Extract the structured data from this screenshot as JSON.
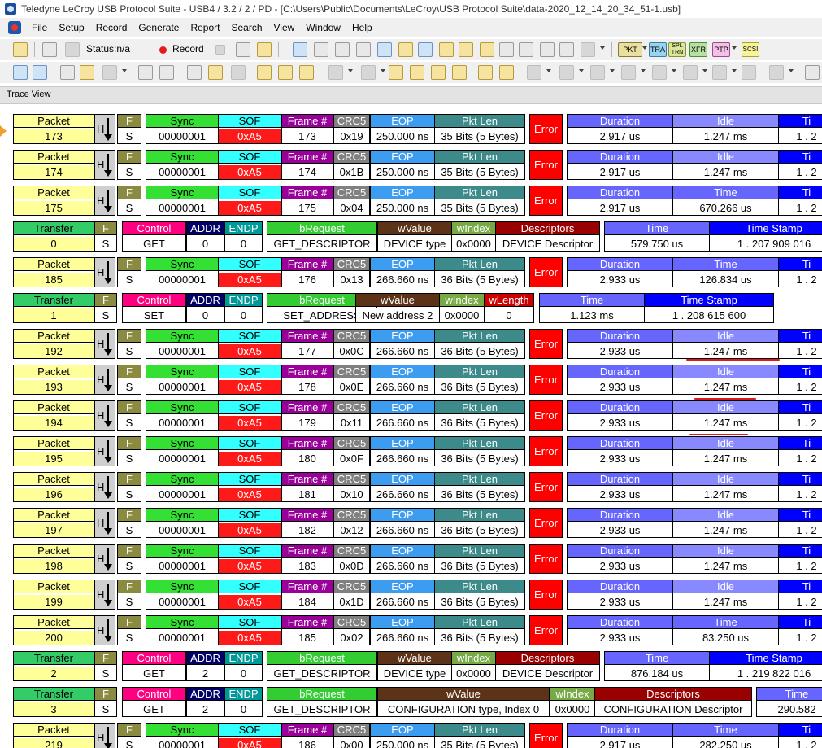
{
  "title": "Teledyne LeCroy USB Protocol Suite - USB4 / 3.2 / 2 / PD - [C:\\Users\\Public\\Documents\\LeCroy\\USB Protocol Suite\\data-2020_12_14_20_34_51-1.usb]",
  "menu": [
    "File",
    "Setup",
    "Record",
    "Generate",
    "Report",
    "Search",
    "View",
    "Window",
    "Help"
  ],
  "toolbar": {
    "status_label": "Status:n/a",
    "record_label": "Record",
    "pkt": "PKT",
    "tra": "TRA",
    "spl": "SPL TRN",
    "xfr": "XFR",
    "ptp": "PTP",
    "scsi": "SCSI"
  },
  "trace_view_title": "Trace View",
  "colors": {
    "yellow": "#ffff99",
    "sync": "#33e033",
    "sof": "#33ffff",
    "sof_val": "#ff1a1a",
    "frame": "#990099",
    "crc": "#808080",
    "eop": "#3c9cf0",
    "pktlen": "#3c8a8a",
    "error": "#ff0000",
    "duration": "#6666ff",
    "idle": "#8888ff",
    "time": "#6666ff",
    "timestamp": "#0000ff",
    "F": "#8a8a40",
    "transfer": "#33cc66",
    "control": "#ff0080",
    "addr": "#000066",
    "endp": "#009999",
    "brequest": "#33cc33",
    "wvalue": "#5c3317",
    "windex": "#77aa44",
    "desc": "#990000",
    "wlength": "#cc0000"
  },
  "records": [
    {
      "kind": "packet",
      "id": "173",
      "f": "S",
      "sync": "00000001",
      "sof": "0xA5",
      "frame": "173",
      "crc": "0x19",
      "eop": "250.000 ns",
      "pktlen": "35 Bits (5 Bytes)",
      "error": "Error",
      "dur": "2.917 us",
      "mid_label": "Idle",
      "mid": "1.247 ms",
      "tail": "1 . 2",
      "mark_left": true
    },
    {
      "kind": "packet",
      "id": "174",
      "f": "S",
      "sync": "00000001",
      "sof": "0xA5",
      "frame": "174",
      "crc": "0x1B",
      "eop": "250.000 ns",
      "pktlen": "35 Bits (5 Bytes)",
      "error": "Error",
      "dur": "2.917 us",
      "mid_label": "Idle",
      "mid": "1.247 ms",
      "tail": "1 . 2"
    },
    {
      "kind": "packet",
      "id": "175",
      "f": "S",
      "sync": "00000001",
      "sof": "0xA5",
      "frame": "175",
      "crc": "0x04",
      "eop": "250.000 ns",
      "pktlen": "35 Bits (5 Bytes)",
      "error": "Error",
      "dur": "2.917 us",
      "mid_label": "Time",
      "mid": "670.266 us",
      "tail": "1 . 2"
    },
    {
      "kind": "transfer",
      "id": "0",
      "f": "S",
      "control": "GET",
      "addr": "0",
      "endp": "0",
      "brequest": "GET_DESCRIPTOR",
      "wvalue": "DEVICE type",
      "windex": "0x0000",
      "desc": "DEVICE Descriptor",
      "time": "579.750 us",
      "stamp": "1 . 207 909 016",
      "variant": "a"
    },
    {
      "kind": "packet",
      "id": "185",
      "f": "S",
      "sync": "00000001",
      "sof": "0xA5",
      "frame": "176",
      "crc": "0x13",
      "eop": "266.660 ns",
      "pktlen": "36 Bits (5 Bytes)",
      "error": "Error",
      "dur": "2.933 us",
      "mid_label": "Time",
      "mid": "126.834 us",
      "tail": "1 . 2"
    },
    {
      "kind": "transfer",
      "id": "1",
      "f": "S",
      "control": "SET",
      "addr": "0",
      "endp": "0",
      "brequest": "SET_ADDRESS",
      "wvalue": "New address 2",
      "windex": "0x0000",
      "wlength": "0",
      "time": "1.123 ms",
      "stamp": "1 . 208 615 600",
      "variant": "b"
    },
    {
      "kind": "packet",
      "id": "192",
      "f": "S",
      "sync": "00000001",
      "sof": "0xA5",
      "frame": "177",
      "crc": "0x0C",
      "eop": "266.660 ns",
      "pktlen": "36 Bits (5 Bytes)",
      "error": "Error",
      "dur": "2.933 us",
      "mid_label": "Idle",
      "mid": "1.247 ms",
      "tail": "1 . 2"
    },
    {
      "kind": "packet",
      "id": "193",
      "f": "S",
      "sync": "00000001",
      "sof": "0xA5",
      "frame": "178",
      "crc": "0x0E",
      "eop": "266.660 ns",
      "pktlen": "36 Bits (5 Bytes)",
      "error": "Error",
      "dur": "2.933 us",
      "mid_label": "Idle",
      "mid": "1.247 ms",
      "tail": "1 . 2"
    },
    {
      "kind": "packet",
      "id": "194",
      "f": "S",
      "sync": "00000001",
      "sof": "0xA5",
      "frame": "179",
      "crc": "0x11",
      "eop": "266.660 ns",
      "pktlen": "36 Bits (5 Bytes)",
      "error": "Error",
      "dur": "2.933 us",
      "mid_label": "Idle",
      "mid": "1.247 ms",
      "tail": "1 . 2"
    },
    {
      "kind": "packet",
      "id": "195",
      "f": "S",
      "sync": "00000001",
      "sof": "0xA5",
      "frame": "180",
      "crc": "0x0F",
      "eop": "266.660 ns",
      "pktlen": "36 Bits (5 Bytes)",
      "error": "Error",
      "dur": "2.933 us",
      "mid_label": "Idle",
      "mid": "1.247 ms",
      "tail": "1 . 2"
    },
    {
      "kind": "packet",
      "id": "196",
      "f": "S",
      "sync": "00000001",
      "sof": "0xA5",
      "frame": "181",
      "crc": "0x10",
      "eop": "266.660 ns",
      "pktlen": "36 Bits (5 Bytes)",
      "error": "Error",
      "dur": "2.933 us",
      "mid_label": "Idle",
      "mid": "1.247 ms",
      "tail": "1 . 2"
    },
    {
      "kind": "packet",
      "id": "197",
      "f": "S",
      "sync": "00000001",
      "sof": "0xA5",
      "frame": "182",
      "crc": "0x12",
      "eop": "266.660 ns",
      "pktlen": "36 Bits (5 Bytes)",
      "error": "Error",
      "dur": "2.933 us",
      "mid_label": "Idle",
      "mid": "1.247 ms",
      "tail": "1 . 2"
    },
    {
      "kind": "packet",
      "id": "198",
      "f": "S",
      "sync": "00000001",
      "sof": "0xA5",
      "frame": "183",
      "crc": "0x0D",
      "eop": "266.660 ns",
      "pktlen": "36 Bits (5 Bytes)",
      "error": "Error",
      "dur": "2.933 us",
      "mid_label": "Idle",
      "mid": "1.247 ms",
      "tail": "1 . 2"
    },
    {
      "kind": "packet",
      "id": "199",
      "f": "S",
      "sync": "00000001",
      "sof": "0xA5",
      "frame": "184",
      "crc": "0x1D",
      "eop": "266.660 ns",
      "pktlen": "36 Bits (5 Bytes)",
      "error": "Error",
      "dur": "2.933 us",
      "mid_label": "Idle",
      "mid": "1.247 ms",
      "tail": "1 . 2"
    },
    {
      "kind": "packet",
      "id": "200",
      "f": "S",
      "sync": "00000001",
      "sof": "0xA5",
      "frame": "185",
      "crc": "0x02",
      "eop": "266.660 ns",
      "pktlen": "36 Bits (5 Bytes)",
      "error": "Error",
      "dur": "2.933 us",
      "mid_label": "Time",
      "mid": "83.250 us",
      "tail": "1 . 2"
    },
    {
      "kind": "transfer",
      "id": "2",
      "f": "S",
      "control": "GET",
      "addr": "2",
      "endp": "0",
      "brequest": "GET_DESCRIPTOR",
      "wvalue": "DEVICE type",
      "windex": "0x0000",
      "desc": "DEVICE Descriptor",
      "time": "876.184 us",
      "stamp": "1 . 219 822 016",
      "variant": "a"
    },
    {
      "kind": "transfer",
      "id": "3",
      "f": "S",
      "control": "GET",
      "addr": "2",
      "endp": "0",
      "brequest": "GET_DESCRIPTOR",
      "wvalue": "CONFIGURATION type, Index 0",
      "windex": "0x0000",
      "desc": "CONFIGURATION Descriptor",
      "time": "290.582",
      "variant": "c"
    },
    {
      "kind": "packet",
      "id": "219",
      "f": "S",
      "sync": "00000001",
      "sof": "0xA5",
      "frame": "186",
      "crc": "0x00",
      "eop": "250.000 ns",
      "pktlen": "35 Bits (5 Bytes)",
      "error": "Error",
      "dur": "2.917 us",
      "mid_label": "Time",
      "mid": "282.250 us",
      "tail": "1 . 2"
    }
  ],
  "labels": {
    "packet": "Packet",
    "transfer": "Transfer",
    "F": "F",
    "H": "H",
    "sync": "Sync",
    "sof": "SOF",
    "frame": "Frame #",
    "crc": "CRC5",
    "eop": "EOP",
    "pktlen": "Pkt Len",
    "duration": "Duration",
    "control": "Control",
    "addr": "ADDR",
    "endp": "ENDP",
    "brequest": "bRequest",
    "wvalue": "wValue",
    "windex": "wIndex",
    "wlength": "wLength",
    "descriptors": "Descriptors",
    "time": "Time",
    "stamp": "Time Stamp",
    "tail_head": "Ti"
  }
}
